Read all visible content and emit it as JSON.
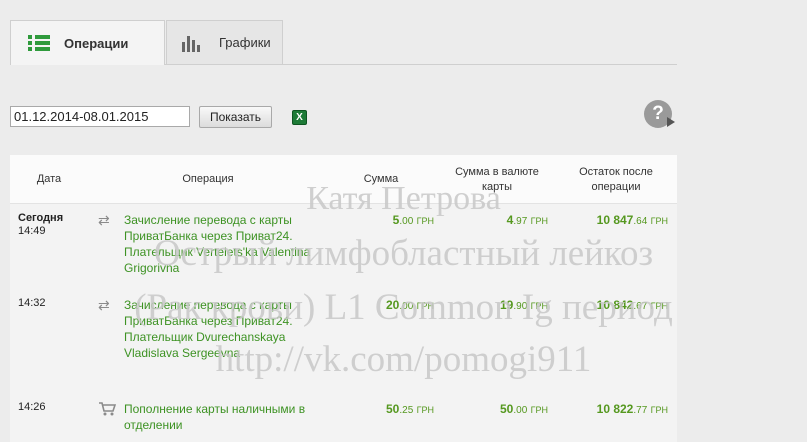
{
  "tabs": [
    {
      "label": "Операции",
      "icon": "list-icon",
      "active": true
    },
    {
      "label": "Графики",
      "icon": "bar-chart-icon",
      "active": false
    }
  ],
  "filter": {
    "date_range": "01.12.2014-08.01.2015",
    "show_button": "Показать",
    "excel_icon": "excel-export-icon",
    "help_icon": "help-icon"
  },
  "table": {
    "headers": {
      "date": "Дата",
      "operation": "Операция",
      "sum": "Сумма",
      "sum_currency": "Сумма в валюте карты",
      "balance": "Остаток после операции"
    },
    "rows": [
      {
        "day": "Сегодня",
        "time": "14:49",
        "icon": "transfer-icon",
        "operation": "Зачисление перевода с карты ПриватБанка через Приват24. Плательщик Vertelets'ka Valentina Grigorivna",
        "sum": {
          "whole": "5",
          "cents": ".00",
          "currency": "ГРН"
        },
        "sum_currency": {
          "whole": "4",
          "cents": ".97",
          "currency": "ГРН"
        },
        "balance": {
          "whole": "10 847",
          "cents": ".64",
          "currency": "ГРН"
        }
      },
      {
        "day": "",
        "time": "14:32",
        "icon": "transfer-icon",
        "operation": "Зачисление перевода с карты ПриватБанка через Приват24. Плательщик Dvurechanskaya Vladislava Sergeevna",
        "sum": {
          "whole": "20",
          "cents": ".00",
          "currency": "ГРН"
        },
        "sum_currency": {
          "whole": "19",
          "cents": ".90",
          "currency": "ГРН"
        },
        "balance": {
          "whole": "10 842",
          "cents": ".67",
          "currency": "ГРН"
        }
      },
      {
        "day": "",
        "time": "14:26",
        "icon": "cart-icon",
        "operation": "Пополнение карты наличными в отделении",
        "sum": {
          "whole": "50",
          "cents": ".25",
          "currency": "ГРН"
        },
        "sum_currency": {
          "whole": "50",
          "cents": ".00",
          "currency": "ГРН"
        },
        "balance": {
          "whole": "10 822",
          "cents": ".77",
          "currency": "ГРН"
        }
      }
    ]
  },
  "watermark": {
    "line1": "Катя Петрова",
    "line2": "Острый лимфобластный лейкоз",
    "line3": "(Рак крови) L1 Common Ig период",
    "line4": "http://vk.com/pomogi911"
  },
  "colors": {
    "accent_green": "#3d9223",
    "amount_green": "#55981f"
  }
}
